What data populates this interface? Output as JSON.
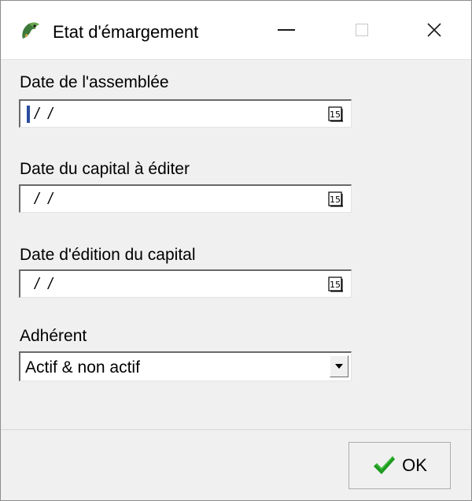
{
  "window": {
    "title": "Etat d'émargement",
    "icon": "app-parrot-icon"
  },
  "controls": {
    "minimize_icon": "minimize-icon",
    "maximize_icon": "maximize-icon",
    "close_icon": "close-icon"
  },
  "fields": {
    "assembly_date": {
      "label": "Date de l'assemblée",
      "value": "/ /"
    },
    "capital_date": {
      "label": "Date du capital à éditer",
      "value": "/ /"
    },
    "edition_date": {
      "label": "Date d'édition du capital",
      "value": "/ /"
    },
    "calendar_icon_text": "15"
  },
  "member": {
    "label": "Adhérent",
    "selected": "Actif & non actif"
  },
  "ok_button": {
    "label": "OK",
    "icon": "checkmark-icon",
    "icon_color": "#1f9a1f"
  }
}
